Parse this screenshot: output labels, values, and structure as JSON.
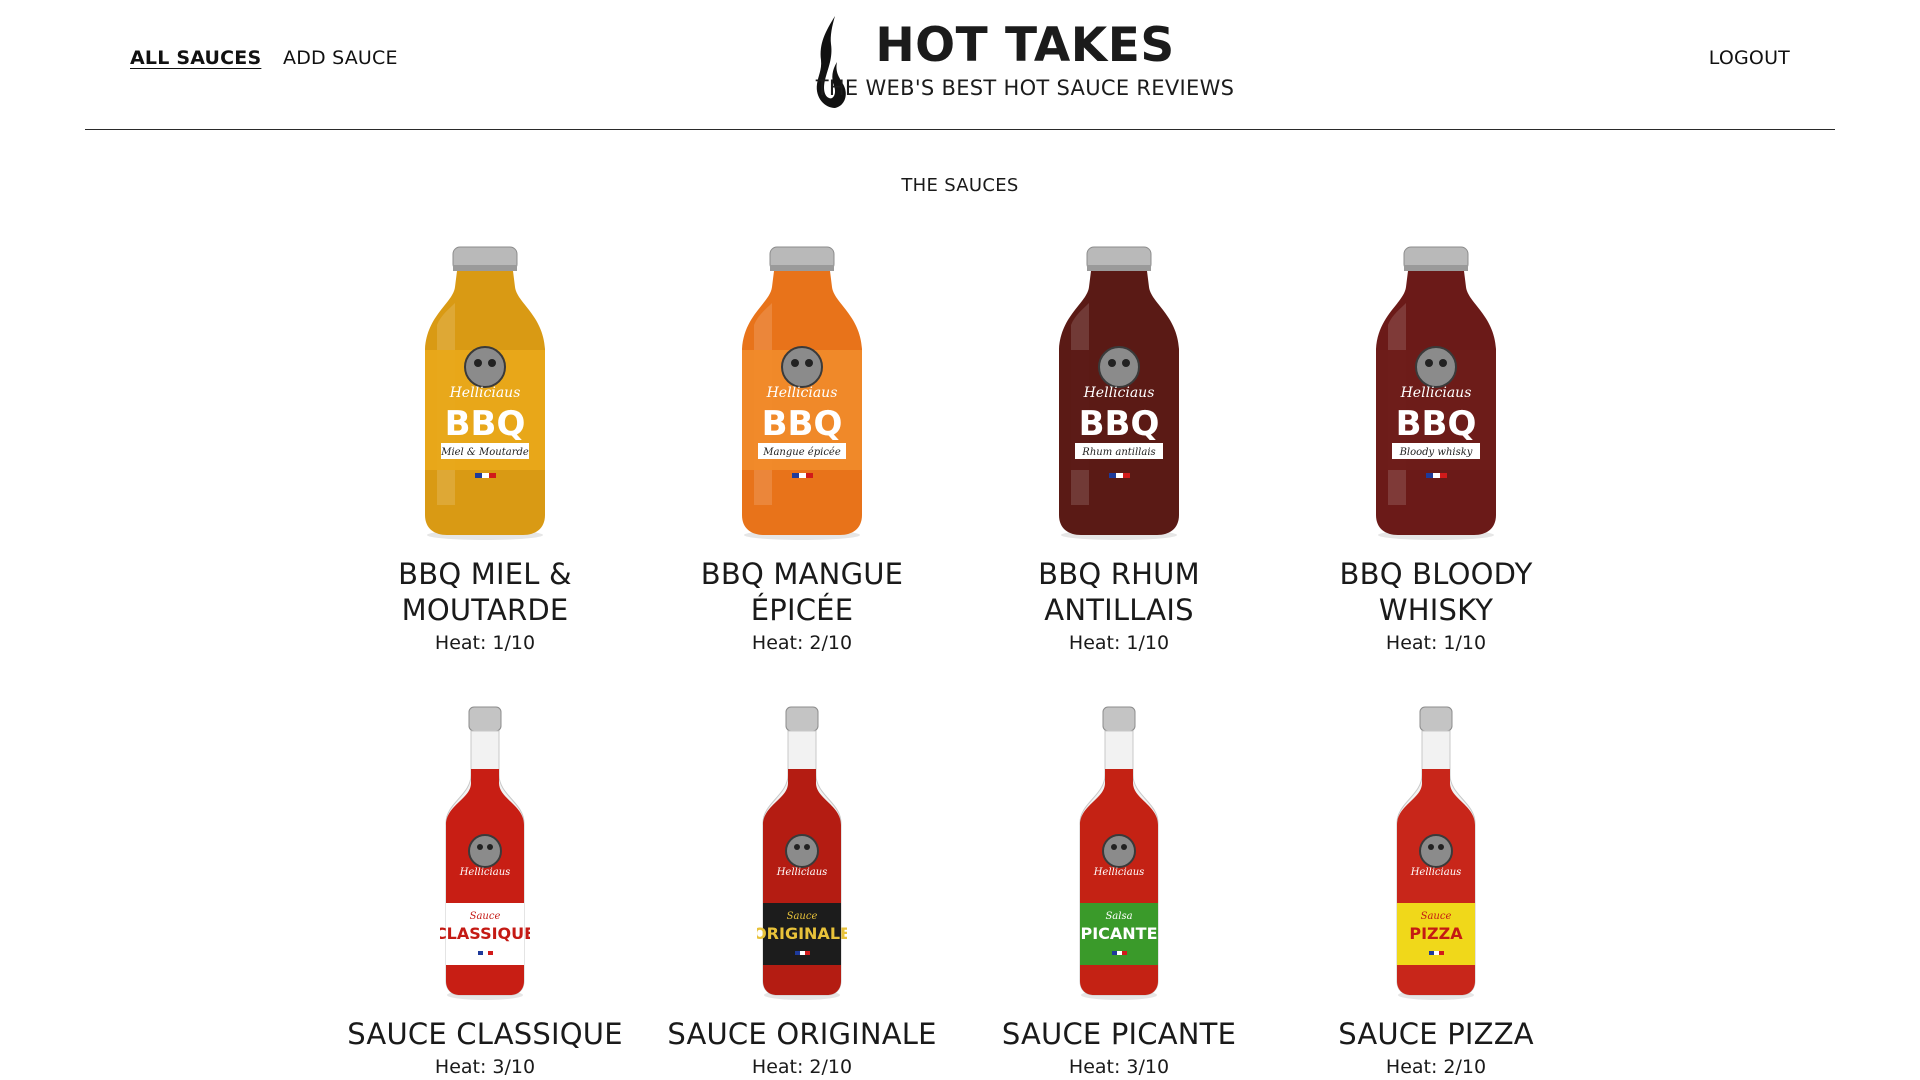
{
  "nav": {
    "all_sauces": "ALL SAUCES",
    "add_sauce": "ADD SAUCE",
    "logout": "LOGOUT"
  },
  "brand": {
    "title": "HOT TAKES",
    "tagline": "THE WEB'S BEST HOT SAUCE REVIEWS"
  },
  "section_title": "THE SAUCES",
  "sauces": [
    {
      "name_line1": "BBQ MIEL &",
      "name_line2": "MOUTARDE",
      "heat": "Heat: 1/10",
      "label_title": "BBQ",
      "label_sub": "Miel & Moutarde",
      "liquid": "#d99a14",
      "label": "#e8a81a",
      "shape": "wide"
    },
    {
      "name_line1": "BBQ MANGUE",
      "name_line2": "ÉPICÉE",
      "heat": "Heat: 2/10",
      "label_title": "BBQ",
      "label_sub": "Mangue épicée",
      "liquid": "#e8731a",
      "label": "#f08a2a",
      "shape": "wide"
    },
    {
      "name_line1": "BBQ RHUM",
      "name_line2": "ANTILLAIS",
      "heat": "Heat: 1/10",
      "label_title": "BBQ",
      "label_sub": "Rhum antillais",
      "liquid": "#5a1a15",
      "label": "#5c1a16",
      "shape": "wide"
    },
    {
      "name_line1": "BBQ BLOODY",
      "name_line2": "WHISKY",
      "heat": "Heat: 1/10",
      "label_title": "BBQ",
      "label_sub": "Bloody whisky",
      "liquid": "#6b1a18",
      "label": "#6d1c19",
      "shape": "wide"
    },
    {
      "name_line1": "SAUCE CLASSIQUE",
      "name_line2": "",
      "heat": "Heat: 3/10",
      "label_title": "CLASSIQUE",
      "label_sub": "Sauce",
      "liquid": "#c81e14",
      "label": "#ffffff",
      "label_text": "#c41a14",
      "shape": "slim"
    },
    {
      "name_line1": "SAUCE ORIGINALE",
      "name_line2": "",
      "heat": "Heat: 2/10",
      "label_title": "ORIGINALE",
      "label_sub": "Sauce",
      "liquid": "#b41c12",
      "label": "#1c1c1c",
      "label_text": "#e8c23a",
      "shape": "slim"
    },
    {
      "name_line1": "SAUCE PICANTE",
      "name_line2": "",
      "heat": "Heat: 3/10",
      "label_title": "PICANTE",
      "label_sub": "Salsa",
      "liquid": "#c42214",
      "label": "#3a9a2a",
      "label_text": "#ffffff",
      "shape": "slim"
    },
    {
      "name_line1": "SAUCE PIZZA",
      "name_line2": "",
      "heat": "Heat: 2/10",
      "label_title": "PIZZA",
      "label_sub": "Sauce",
      "liquid": "#c8261a",
      "label": "#f0d81a",
      "label_text": "#c41a14",
      "shape": "slim"
    }
  ]
}
